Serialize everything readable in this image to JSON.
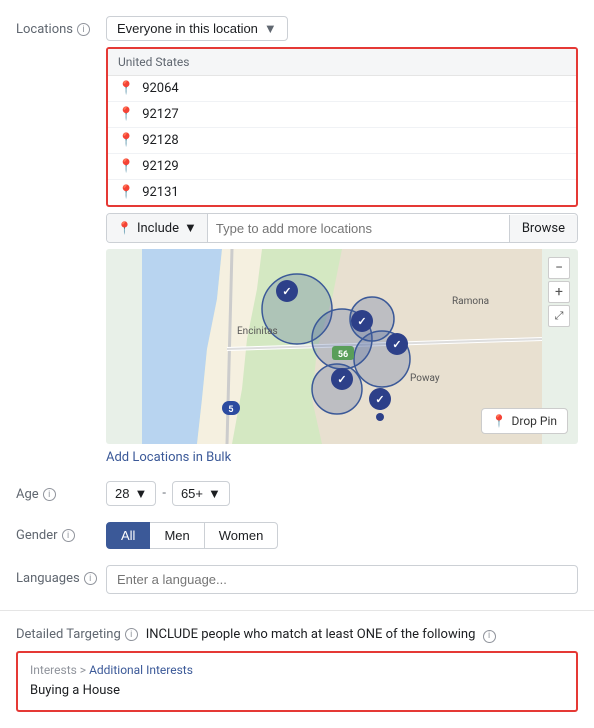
{
  "locations": {
    "label": "Locations",
    "dropdown_label": "Everyone in this location",
    "dropdown_chevron": "▼",
    "header_country": "United States",
    "items": [
      {
        "zip": "92064"
      },
      {
        "zip": "92127"
      },
      {
        "zip": "92128"
      },
      {
        "zip": "92129"
      },
      {
        "zip": "92131"
      }
    ],
    "include_label": "Include",
    "include_chevron": "▼",
    "include_placeholder": "Type to add more locations",
    "browse_label": "Browse",
    "bulk_link": "Add Locations in Bulk",
    "drop_pin_label": "Drop Pin"
  },
  "age": {
    "label": "Age",
    "min": "28",
    "min_chevron": "▼",
    "dash": "-",
    "max": "65+",
    "max_chevron": "▼"
  },
  "gender": {
    "label": "Gender",
    "buttons": [
      {
        "label": "All",
        "active": true
      },
      {
        "label": "Men",
        "active": false
      },
      {
        "label": "Women",
        "active": false
      }
    ]
  },
  "languages": {
    "label": "Languages",
    "placeholder": "Enter a language..."
  },
  "detailed_targeting": {
    "label": "Detailed Targeting",
    "description": "INCLUDE people who match at least ONE of the following",
    "info": "ℹ",
    "box": {
      "breadcrumb_prefix": "Interests",
      "breadcrumb_separator": " > ",
      "breadcrumb_link": "Additional Interests",
      "item": "Buying a House"
    }
  },
  "map": {
    "zoom_in": "+",
    "zoom_out": "−",
    "fullscreen": "⤢",
    "label_encinitas": "Encinitas",
    "label_ramona": "Ramona",
    "label_poway": "Poway",
    "highway_56": "56",
    "highway_5": "5"
  }
}
